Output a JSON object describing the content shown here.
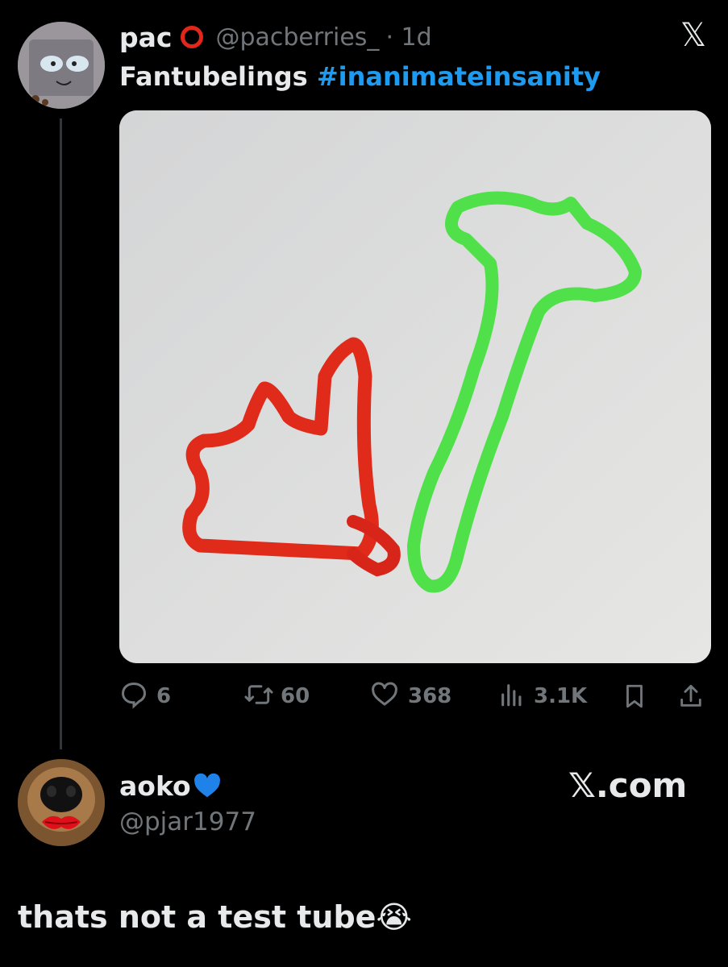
{
  "post": {
    "author_name": "pac",
    "handle": "@pacberries_",
    "dot_time": "· 1d",
    "text": "Fantubelings",
    "hashtag": "#inanimateinsanity",
    "media_alt": "pipe cleaner shapes"
  },
  "actions": {
    "replies": "6",
    "reposts": "60",
    "likes": "368",
    "views": "3.1K"
  },
  "reply": {
    "author_name": "aoko",
    "handle": "@pjar1977",
    "text": "thats not a test tube",
    "emoji": "😭"
  },
  "watermark": {
    "text": "𝕏.com"
  },
  "close_symbol": "𝕏",
  "colors": {
    "background": "#000000",
    "link": "#1d9bf0",
    "muted": "#71767b",
    "red_cleaner": "#e02a1a",
    "green_cleaner": "#4fe04a"
  }
}
